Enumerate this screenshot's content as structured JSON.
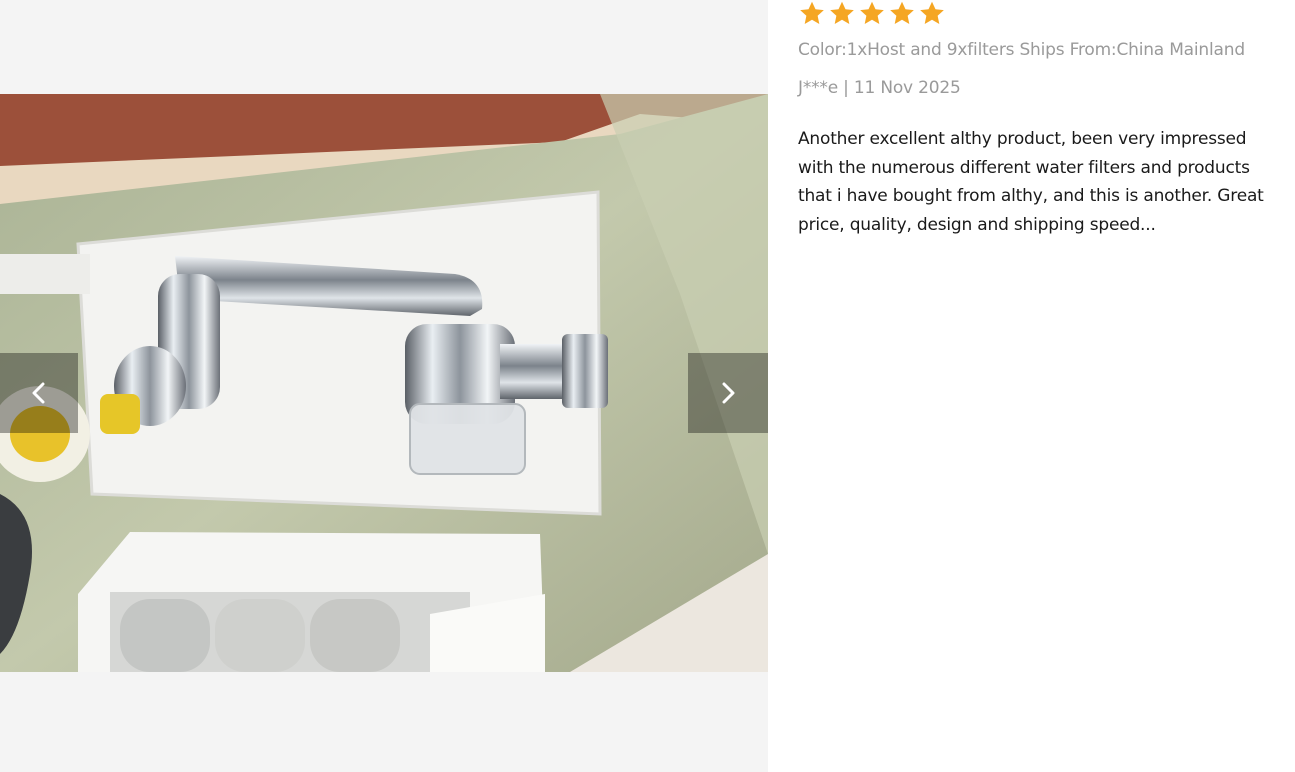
{
  "gallery": {
    "photo_alt": "Review photo of faucet and filters",
    "prev_icon": "chevron-left-icon",
    "next_icon": "chevron-right-icon"
  },
  "review": {
    "rating": 5,
    "max_rating": 5,
    "star_color": "#f5a623",
    "sku_text": "Color:1xHost and 9xfilters Ships From:China Mainland",
    "user_date": "J***e | 11 Nov 2025",
    "body": "Another excellent althy product, been very impressed with the numerous different water filters and products that i have bought from althy, and this is another. Great price, quality, design and shipping speed..."
  }
}
